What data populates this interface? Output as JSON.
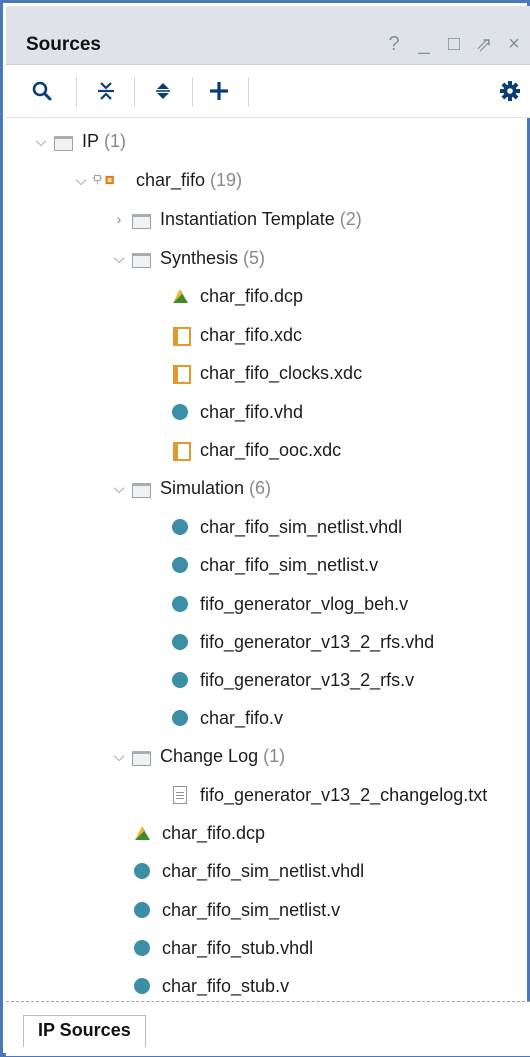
{
  "window": {
    "title": "Sources",
    "controls": [
      "?",
      "_",
      "□",
      "⇗",
      "×"
    ]
  },
  "toolbar": {
    "icons": [
      "search-icon",
      "collapse-all-icon",
      "expand-icon",
      "add-icon",
      "gear-icon"
    ],
    "accent": "#0b3e74"
  },
  "tree": {
    "ip": {
      "label": "IP",
      "count": "(1)"
    },
    "char_fifo": {
      "label": "char_fifo",
      "count": "(19)"
    },
    "instantiation": {
      "label": "Instantiation Template",
      "count": "(2)"
    },
    "synthesis": {
      "label": "Synthesis",
      "count": "(5)"
    },
    "synthesis_files": [
      "char_fifo.dcp",
      "char_fifo.xdc",
      "char_fifo_clocks.xdc",
      "char_fifo.vhd",
      "char_fifo_ooc.xdc"
    ],
    "simulation": {
      "label": "Simulation",
      "count": "(6)"
    },
    "simulation_files": [
      "char_fifo_sim_netlist.vhdl",
      "char_fifo_sim_netlist.v",
      "fifo_generator_vlog_beh.v",
      "fifo_generator_v13_2_rfs.vhd",
      "fifo_generator_v13_2_rfs.v",
      "char_fifo.v"
    ],
    "changelog": {
      "label": "Change Log",
      "count": "(1)"
    },
    "changelog_files": [
      "fifo_generator_v13_2_changelog.txt"
    ],
    "root_files": [
      "char_fifo.dcp",
      "char_fifo_sim_netlist.vhdl",
      "char_fifo_sim_netlist.v",
      "char_fifo_stub.vhdl",
      "char_fifo_stub.v"
    ]
  },
  "tabs": {
    "active": "IP Sources"
  },
  "colors": {
    "file_dot": "#3b8ea5",
    "xdc": "#e39a2c",
    "frame": "#4a78b8"
  }
}
